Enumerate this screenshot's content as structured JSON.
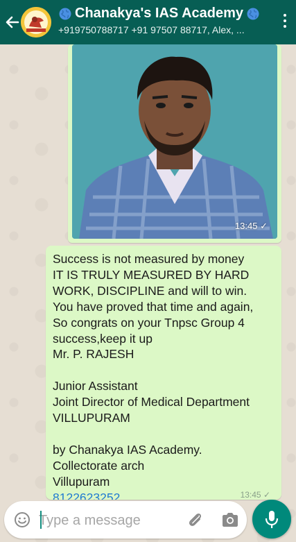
{
  "header": {
    "title": "Chanakya's IAS Academy",
    "subtitle": "+919750788717 +91 97507 88717, Alex, ...",
    "back_icon": "arrow-left-icon",
    "menu_icon": "more-vert-icon"
  },
  "messages": {
    "image_time": "13:45",
    "text_lines": [
      "Success is not measured by money",
      "IT IS TRULY MEASURED BY HARD",
      "WORK, DISCIPLINE and will to win.",
      "You have proved that time and again,",
      "So congrats on your Tnpsc Group 4",
      "success,keep it up",
      "Mr. P. RAJESH",
      "",
      "Junior Assistant",
      "Joint Director of Medical Department",
      "VILLUPURAM",
      "",
      "by Chanakya IAS Academy.",
      "Collectorate arch",
      "Villupuram"
    ],
    "phone": "8122623252",
    "text_time": "13:45"
  },
  "composer": {
    "placeholder": "Type a message"
  },
  "colors": {
    "header": "#075e54",
    "bubble": "#dcf8c6",
    "mic": "#00897b"
  }
}
